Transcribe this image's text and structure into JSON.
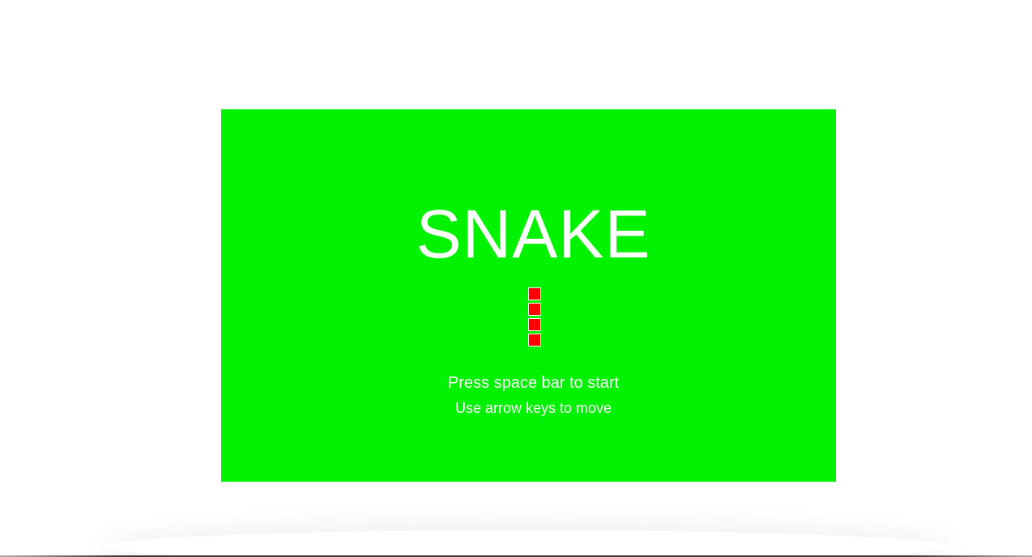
{
  "game": {
    "title": "SNAKE",
    "instructions": {
      "start": "Press space bar to start",
      "move": "Use arrow keys to move"
    },
    "snake_segments": 4,
    "colors": {
      "board": "#00f200",
      "snake": "#ff0000",
      "text": "#ffffff",
      "page_background": "#ffffff"
    }
  }
}
